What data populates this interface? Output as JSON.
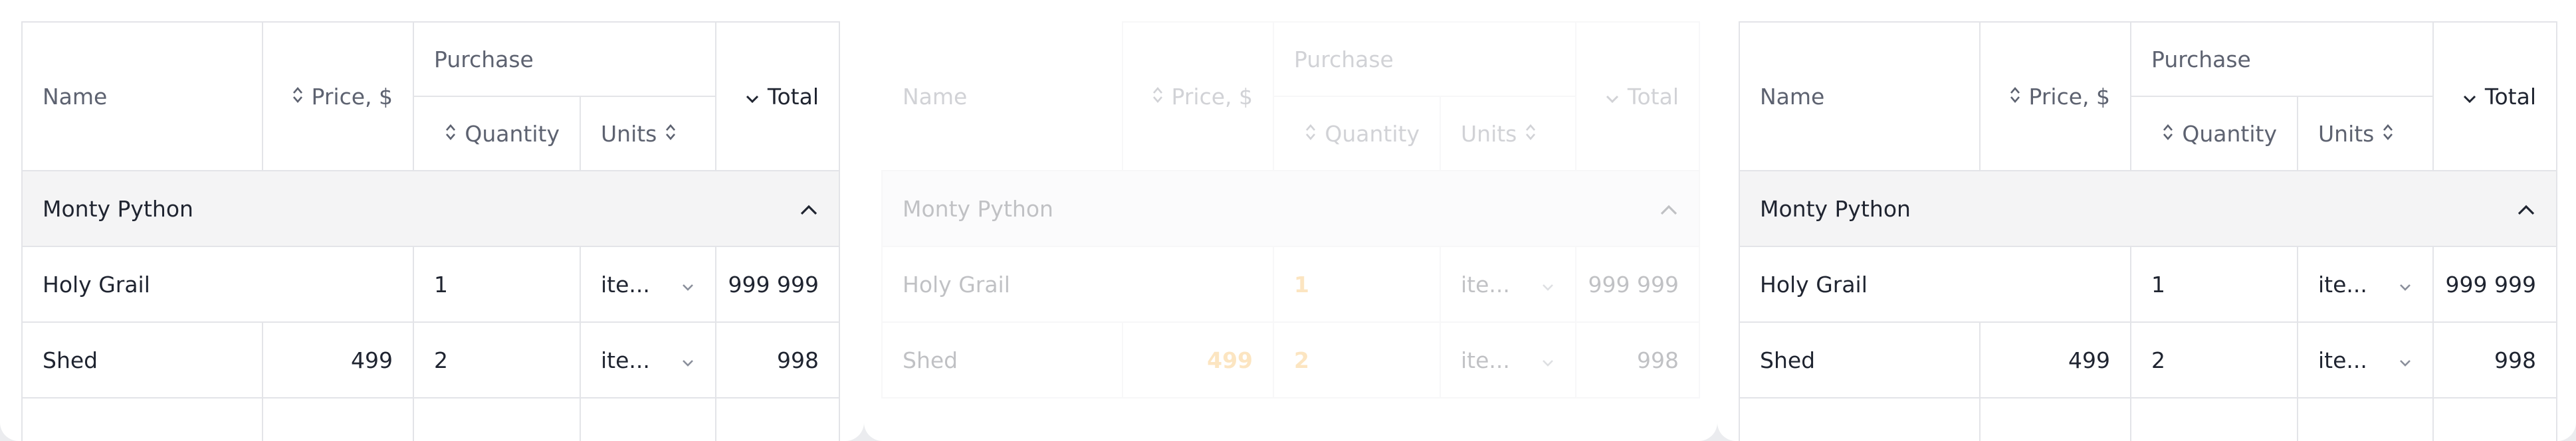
{
  "table": {
    "headers": {
      "name": "Name",
      "price": "Price, $",
      "purchase": "Purchase",
      "quantity": "Quantity",
      "units": "Units",
      "total": "Total"
    },
    "group": {
      "label": "Monty Python",
      "icon": "chevron-up-icon"
    },
    "rows": [
      {
        "name": "Holy Grail",
        "price": "",
        "quantity": "1",
        "units": "ite...",
        "total": "999 999"
      },
      {
        "name": "Shed",
        "price": "499",
        "quantity": "2",
        "units": "ite...",
        "total": "998"
      }
    ],
    "accent_color": "#f5a623",
    "border_color": "#e3e4e8"
  }
}
